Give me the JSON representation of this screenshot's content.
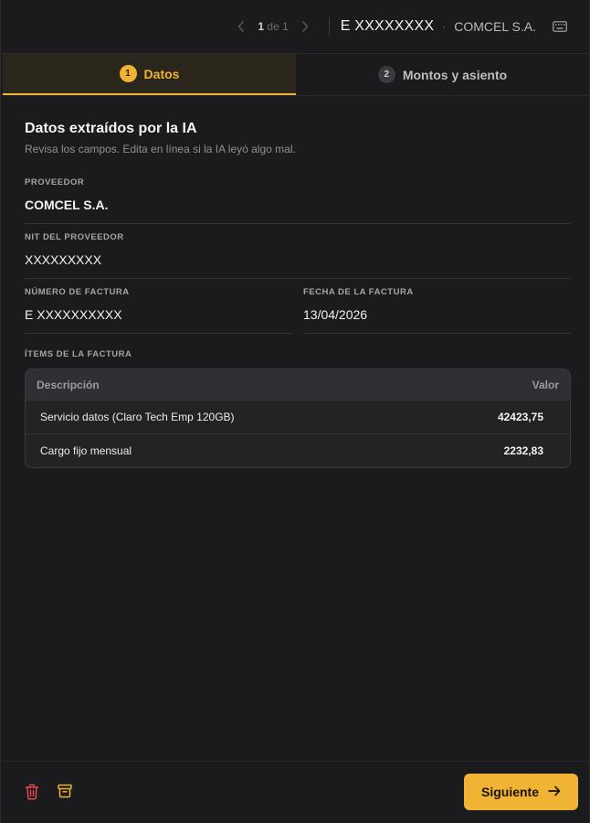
{
  "header": {
    "pager_current": "1",
    "pager_of": "de 1",
    "doc_id": "E XXXXXXXX",
    "vendor": "COMCEL S.A."
  },
  "tabs": [
    {
      "num": "1",
      "label": "Datos"
    },
    {
      "num": "2",
      "label": "Montos y asiento"
    }
  ],
  "section": {
    "title": "Datos extraídos por la IA",
    "subtitle": "Revisa los campos. Edita en línea si la IA leyó algo mal."
  },
  "fields": {
    "proveedor": {
      "label": "PROVEEDOR",
      "value": "COMCEL S.A."
    },
    "nit": {
      "label": "NIT DEL PROVEEDOR",
      "value": "XXXXXXXXX"
    },
    "numero": {
      "label": "NÚMERO DE FACTURA",
      "value": "E XXXXXXXXXX"
    },
    "fecha": {
      "label": "FECHA DE LA FACTURA",
      "value": "13/04/2026"
    }
  },
  "items": {
    "label": "ÍTEMS DE LA FACTURA",
    "col_desc": "Descripción",
    "col_valor": "Valor",
    "rows": [
      {
        "desc": "Servicio datos (Claro Tech Emp 120GB)",
        "valor": "42423,75"
      },
      {
        "desc": "Cargo fijo mensual",
        "valor": "2232,83"
      }
    ]
  },
  "footer": {
    "next_label": "Siguiente"
  },
  "colors": {
    "accent": "#f0b333",
    "danger": "#e5484d",
    "background": "#1b1b1d"
  },
  "icons": {
    "prev": "chevron-left-icon",
    "next_page": "chevron-right-icon",
    "keyboard": "keyboard-icon",
    "trash": "trash-icon",
    "archive": "archive-icon",
    "arrow": "arrow-right-icon"
  }
}
